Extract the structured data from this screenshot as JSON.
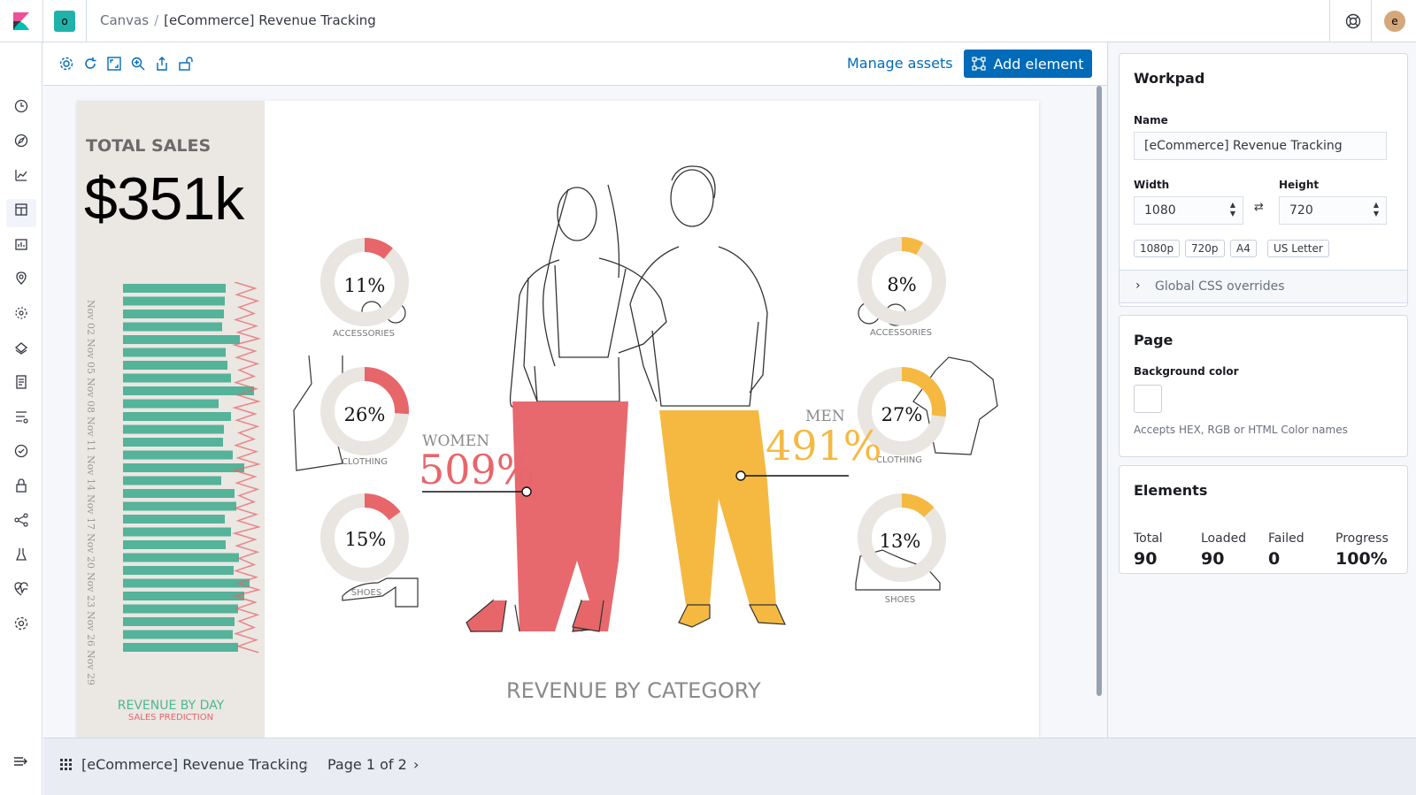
{
  "header": {
    "space_initial": "o",
    "breadcrumbs": [
      "Canvas",
      "[eCommerce] Revenue Tracking"
    ],
    "user_initial": "e"
  },
  "sidenav": {
    "icons": [
      "clock-icon",
      "compass-icon",
      "visualize-icon",
      "dashboard-icon",
      "canvas-icon",
      "maps-icon",
      "ml-icon",
      "infrastructure-icon",
      "logs-icon",
      "apm-icon",
      "uptime-icon",
      "security-icon",
      "graph-icon",
      "dev-tools-icon",
      "monitoring-icon",
      "management-icon"
    ]
  },
  "toolbar": {
    "manage_assets": "Manage assets",
    "add_element": "Add element"
  },
  "canvas": {
    "total_sales_label": "TOTAL SALES",
    "total_sales_value": "$351k",
    "revenue_by_day": "REVENUE BY DAY",
    "sales_prediction": "SALES PREDICTION",
    "day_labels": [
      "Nov 02",
      "Nov 05",
      "Nov 08",
      "Nov 11",
      "Nov 14",
      "Nov 17",
      "Nov 20",
      "Nov 23",
      "Nov 26",
      "Nov 29"
    ],
    "women_label": "WOMEN",
    "women_pct": "509%",
    "men_label": "MEN",
    "men_pct": "491%",
    "revenue_by_category": "REVENUE BY CATEGORY",
    "women_categories": [
      {
        "pct": "11%",
        "label": "ACCESSORIES",
        "value": 11
      },
      {
        "pct": "26%",
        "label": "CLOTHING",
        "value": 26
      },
      {
        "pct": "15%",
        "label": "SHOES",
        "value": 15
      }
    ],
    "men_categories": [
      {
        "pct": "8%",
        "label": "ACCESSORIES",
        "value": 8
      },
      {
        "pct": "27%",
        "label": "CLOTHING",
        "value": 27
      },
      {
        "pct": "13%",
        "label": "SHOES",
        "value": 13
      }
    ],
    "colors": {
      "women": "#e7666a",
      "men": "#f5b942",
      "bars": "#54b399",
      "prediction": "#e7666a",
      "ring": "#e9e5e1"
    }
  },
  "bottombar": {
    "workpad_title": "[eCommerce] Revenue Tracking",
    "page_indicator": "Page 1 of 2"
  },
  "sidebar": {
    "workpad": {
      "title": "Workpad",
      "name_label": "Name",
      "name_value": "[eCommerce] Revenue Tracking",
      "width_label": "Width",
      "width_value": "1080",
      "height_label": "Height",
      "height_value": "720",
      "presets": [
        "1080p",
        "720p",
        "A4",
        "US Letter"
      ],
      "css_overrides": "Global CSS overrides"
    },
    "page": {
      "title": "Page",
      "bg_label": "Background color",
      "bg_help": "Accepts HEX, RGB or HTML Color names"
    },
    "elements": {
      "title": "Elements",
      "stats": [
        {
          "label": "Total",
          "value": "90"
        },
        {
          "label": "Loaded",
          "value": "90"
        },
        {
          "label": "Failed",
          "value": "0"
        },
        {
          "label": "Progress",
          "value": "100%"
        }
      ]
    }
  }
}
